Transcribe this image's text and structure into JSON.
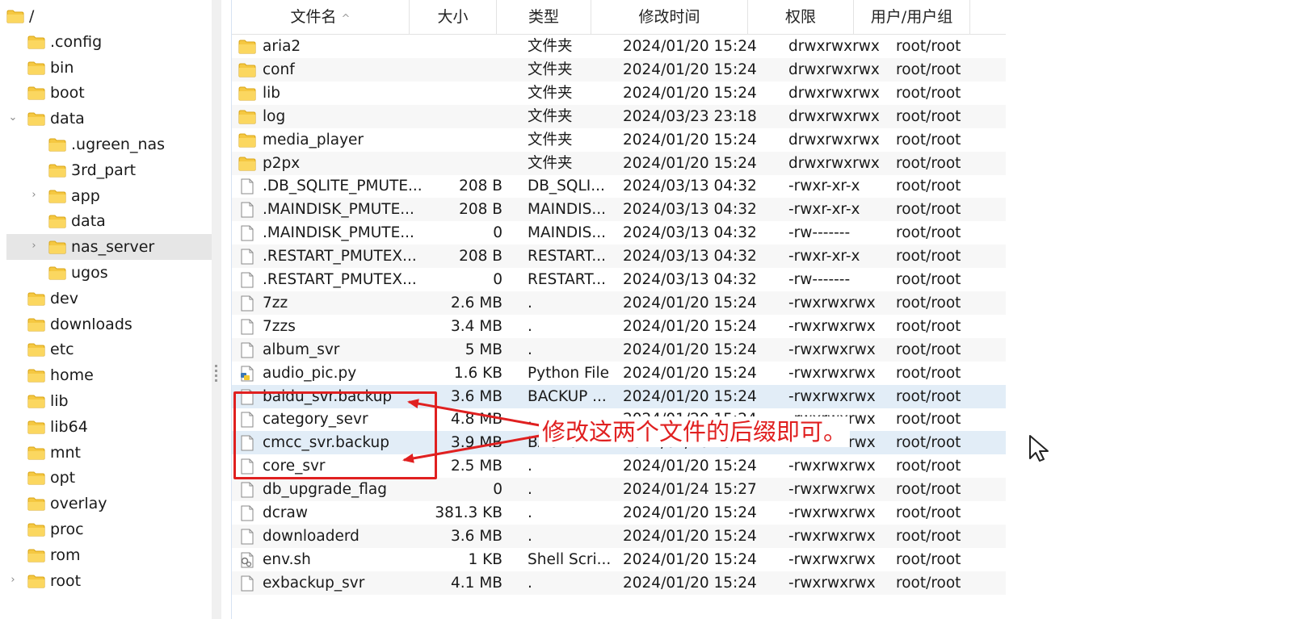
{
  "tree": {
    "items": [
      {
        "label": "/",
        "level": 0,
        "expanded": true,
        "chevron": "none"
      },
      {
        "label": ".config",
        "level": 1,
        "chevron": "none"
      },
      {
        "label": "bin",
        "level": 1,
        "chevron": "none"
      },
      {
        "label": "boot",
        "level": 1,
        "chevron": "none"
      },
      {
        "label": "data",
        "level": 1,
        "expanded": true,
        "chevron": "down"
      },
      {
        "label": ".ugreen_nas",
        "level": 2,
        "chevron": "none"
      },
      {
        "label": "3rd_part",
        "level": 2,
        "chevron": "none"
      },
      {
        "label": "app",
        "level": 2,
        "chevron": "right"
      },
      {
        "label": "data",
        "level": 2,
        "chevron": "none"
      },
      {
        "label": "nas_server",
        "level": 2,
        "chevron": "right",
        "selected": true
      },
      {
        "label": "ugos",
        "level": 2,
        "chevron": "none"
      },
      {
        "label": "dev",
        "level": 1,
        "chevron": "none"
      },
      {
        "label": "downloads",
        "level": 1,
        "chevron": "none"
      },
      {
        "label": "etc",
        "level": 1,
        "chevron": "none"
      },
      {
        "label": "home",
        "level": 1,
        "chevron": "none"
      },
      {
        "label": "lib",
        "level": 1,
        "chevron": "none"
      },
      {
        "label": "lib64",
        "level": 1,
        "chevron": "none",
        "icon": "folder-link-icon"
      },
      {
        "label": "mnt",
        "level": 1,
        "chevron": "none"
      },
      {
        "label": "opt",
        "level": 1,
        "chevron": "none"
      },
      {
        "label": "overlay",
        "level": 1,
        "chevron": "none"
      },
      {
        "label": "proc",
        "level": 1,
        "chevron": "none"
      },
      {
        "label": "rom",
        "level": 1,
        "chevron": "none"
      },
      {
        "label": "root",
        "level": 1,
        "chevron": "right"
      }
    ]
  },
  "list": {
    "columns": [
      "文件名",
      "大小",
      "类型",
      "修改时间",
      "权限",
      "用户/用户组"
    ],
    "sort_indicator": "^",
    "rows": [
      {
        "icon": "folder-icon",
        "name": "aria2",
        "size": "",
        "type": "文件夹",
        "modified": "2024/01/20 15:24",
        "perm": "drwxrwxrwx",
        "owner": "root/root"
      },
      {
        "icon": "folder-icon",
        "name": "conf",
        "size": "",
        "type": "文件夹",
        "modified": "2024/01/20 15:24",
        "perm": "drwxrwxrwx",
        "owner": "root/root"
      },
      {
        "icon": "folder-icon",
        "name": "lib",
        "size": "",
        "type": "文件夹",
        "modified": "2024/01/20 15:24",
        "perm": "drwxrwxrwx",
        "owner": "root/root"
      },
      {
        "icon": "folder-icon",
        "name": "log",
        "size": "",
        "type": "文件夹",
        "modified": "2024/03/23 23:18",
        "perm": "drwxrwxrwx",
        "owner": "root/root"
      },
      {
        "icon": "folder-icon",
        "name": "media_player",
        "size": "",
        "type": "文件夹",
        "modified": "2024/01/20 15:24",
        "perm": "drwxrwxrwx",
        "owner": "root/root"
      },
      {
        "icon": "folder-icon",
        "name": "p2px",
        "size": "",
        "type": "文件夹",
        "modified": "2024/01/20 15:24",
        "perm": "drwxrwxrwx",
        "owner": "root/root"
      },
      {
        "icon": "file-icon",
        "name": ".DB_SQLITE_PMUTE...",
        "size": "208 B",
        "type": "DB_SQLI...",
        "modified": "2024/03/13 04:32",
        "perm": "-rwxr-xr-x",
        "owner": "root/root"
      },
      {
        "icon": "file-icon",
        "name": ".MAINDISK_PMUTE...",
        "size": "208 B",
        "type": "MAINDIS...",
        "modified": "2024/03/13 04:32",
        "perm": "-rwxr-xr-x",
        "owner": "root/root"
      },
      {
        "icon": "file-icon",
        "name": ".MAINDISK_PMUTE...",
        "size": "0",
        "type": "MAINDIS...",
        "modified": "2024/03/13 04:32",
        "perm": "-rw-------",
        "owner": "root/root"
      },
      {
        "icon": "file-icon",
        "name": ".RESTART_PMUTEX...",
        "size": "208 B",
        "type": "RESTART...",
        "modified": "2024/03/13 04:32",
        "perm": "-rwxr-xr-x",
        "owner": "root/root"
      },
      {
        "icon": "file-icon",
        "name": ".RESTART_PMUTEX...",
        "size": "0",
        "type": "RESTART...",
        "modified": "2024/03/13 04:32",
        "perm": "-rw-------",
        "owner": "root/root"
      },
      {
        "icon": "file-icon",
        "name": "7zz",
        "size": "2.6 MB",
        "type": ".",
        "modified": "2024/01/20 15:24",
        "perm": "-rwxrwxrwx",
        "owner": "root/root"
      },
      {
        "icon": "file-icon",
        "name": "7zzs",
        "size": "3.4 MB",
        "type": ".",
        "modified": "2024/01/20 15:24",
        "perm": "-rwxrwxrwx",
        "owner": "root/root"
      },
      {
        "icon": "file-icon",
        "name": "album_svr",
        "size": "5 MB",
        "type": ".",
        "modified": "2024/01/20 15:24",
        "perm": "-rwxrwxrwx",
        "owner": "root/root"
      },
      {
        "icon": "python-file-icon",
        "name": "audio_pic.py",
        "size": "1.6 KB",
        "type": "Python File",
        "modified": "2024/01/20 15:24",
        "perm": "-rwxrwxrwx",
        "owner": "root/root"
      },
      {
        "icon": "file-icon",
        "name": "baidu_svr.backup",
        "size": "3.6 MB",
        "type": "BACKUP ...",
        "modified": "2024/01/20 15:24",
        "perm": "-rwxrwxrwx",
        "owner": "root/root",
        "highlight": true
      },
      {
        "icon": "file-icon",
        "name": "category_sevr",
        "size": "4.8 MB",
        "type": ".",
        "modified": "2024/01/20 15:24",
        "perm": "-rwxrwxrwx",
        "owner": "root/root"
      },
      {
        "icon": "file-icon",
        "name": "cmcc_svr.backup",
        "size": "3.9 MB",
        "type": "BACKUP ...",
        "modified": "2024/01/20 15:24",
        "perm": "-rwxrwxrwx",
        "owner": "root/root",
        "highlight": true
      },
      {
        "icon": "file-icon",
        "name": "core_svr",
        "size": "2.5 MB",
        "type": ".",
        "modified": "2024/01/20 15:24",
        "perm": "-rwxrwxrwx",
        "owner": "root/root"
      },
      {
        "icon": "file-icon",
        "name": "db_upgrade_flag",
        "size": "0",
        "type": ".",
        "modified": "2024/01/24 15:27",
        "perm": "-rwxrwxrwx",
        "owner": "root/root"
      },
      {
        "icon": "file-icon",
        "name": "dcraw",
        "size": "381.3 KB",
        "type": ".",
        "modified": "2024/01/20 15:24",
        "perm": "-rwxrwxrwx",
        "owner": "root/root"
      },
      {
        "icon": "file-icon",
        "name": "downloaderd",
        "size": "3.6 MB",
        "type": ".",
        "modified": "2024/01/20 15:24",
        "perm": "-rwxrwxrwx",
        "owner": "root/root"
      },
      {
        "icon": "shell-script-icon",
        "name": "env.sh",
        "size": "1 KB",
        "type": "Shell Scri...",
        "modified": "2024/01/20 15:24",
        "perm": "-rwxrwxrwx",
        "owner": "root/root"
      },
      {
        "icon": "file-icon",
        "name": "exbackup_svr",
        "size": "4.1 MB",
        "type": ".",
        "modified": "2024/01/20 15:24",
        "perm": "-rwxrwxrwx",
        "owner": "root/root"
      }
    ]
  },
  "annotation": {
    "text": "修改这两个文件的后缀即可。",
    "color": "#e02020"
  },
  "colors": {
    "folder": "#f5c842",
    "highlight_row": "#e2edf7",
    "selected_tree": "#e6e6e6"
  }
}
